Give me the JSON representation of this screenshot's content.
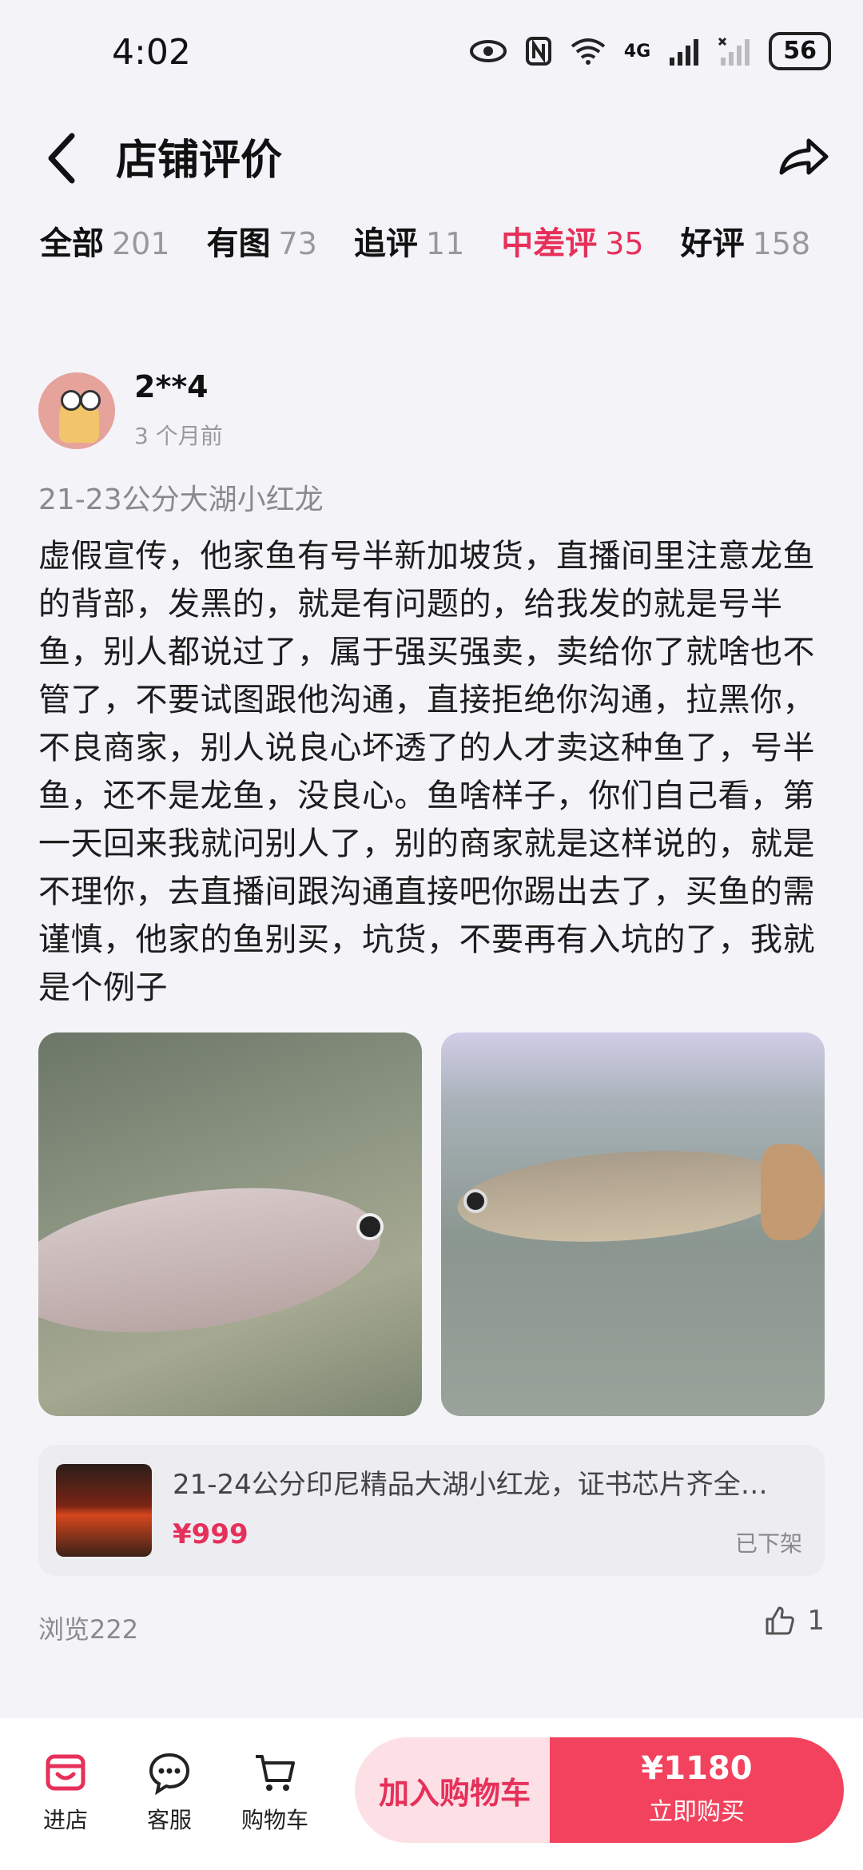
{
  "status_bar": {
    "time": "4:02",
    "network": "4G",
    "battery": "56"
  },
  "header": {
    "title": "店铺评价"
  },
  "tabs": [
    {
      "label": "全部",
      "count": "201"
    },
    {
      "label": "有图",
      "count": "73"
    },
    {
      "label": "追评",
      "count": "11"
    },
    {
      "label": "中差评",
      "count": "35"
    },
    {
      "label": "好评",
      "count": "158"
    }
  ],
  "review": {
    "username": "2**4",
    "time_ago": "3 个月前",
    "spec": "21-23公分大湖小红龙",
    "content": "虚假宣传，他家鱼有号半新加坡货，直播间里注意龙鱼的背部，发黑的，就是有问题的，给我发的就是号半鱼，别人都说过了，属于强买强卖，卖给你了就啥也不管了，不要试图跟他沟通，直接拒绝你沟通，拉黑你，不良商家，别人说良心坏透了的人才卖这种鱼了，号半鱼，还不是龙鱼，没良心。鱼啥样子，你们自己看，第一天回来我就问别人了，别的商家就是这样说的，就是不理你，去直播间跟沟通直接吧你踢出去了，买鱼的需谨慎，他家的鱼别买，坑货，不要再有入坑的了，我就是个例子",
    "views": "浏览222",
    "likes": "1"
  },
  "product": {
    "name": "21-24公分印尼精品大湖小红龙，证书芯片齐全…",
    "price": "¥999",
    "status": "已下架"
  },
  "bottom": {
    "store_label": "进店",
    "service_label": "客服",
    "cart_label": "购物车",
    "add_cart_label": "加入购物车",
    "buy_price": "¥1180",
    "buy_label": "立即购买"
  },
  "colors": {
    "accent": "#e6305a",
    "buy": "#f2425d"
  }
}
